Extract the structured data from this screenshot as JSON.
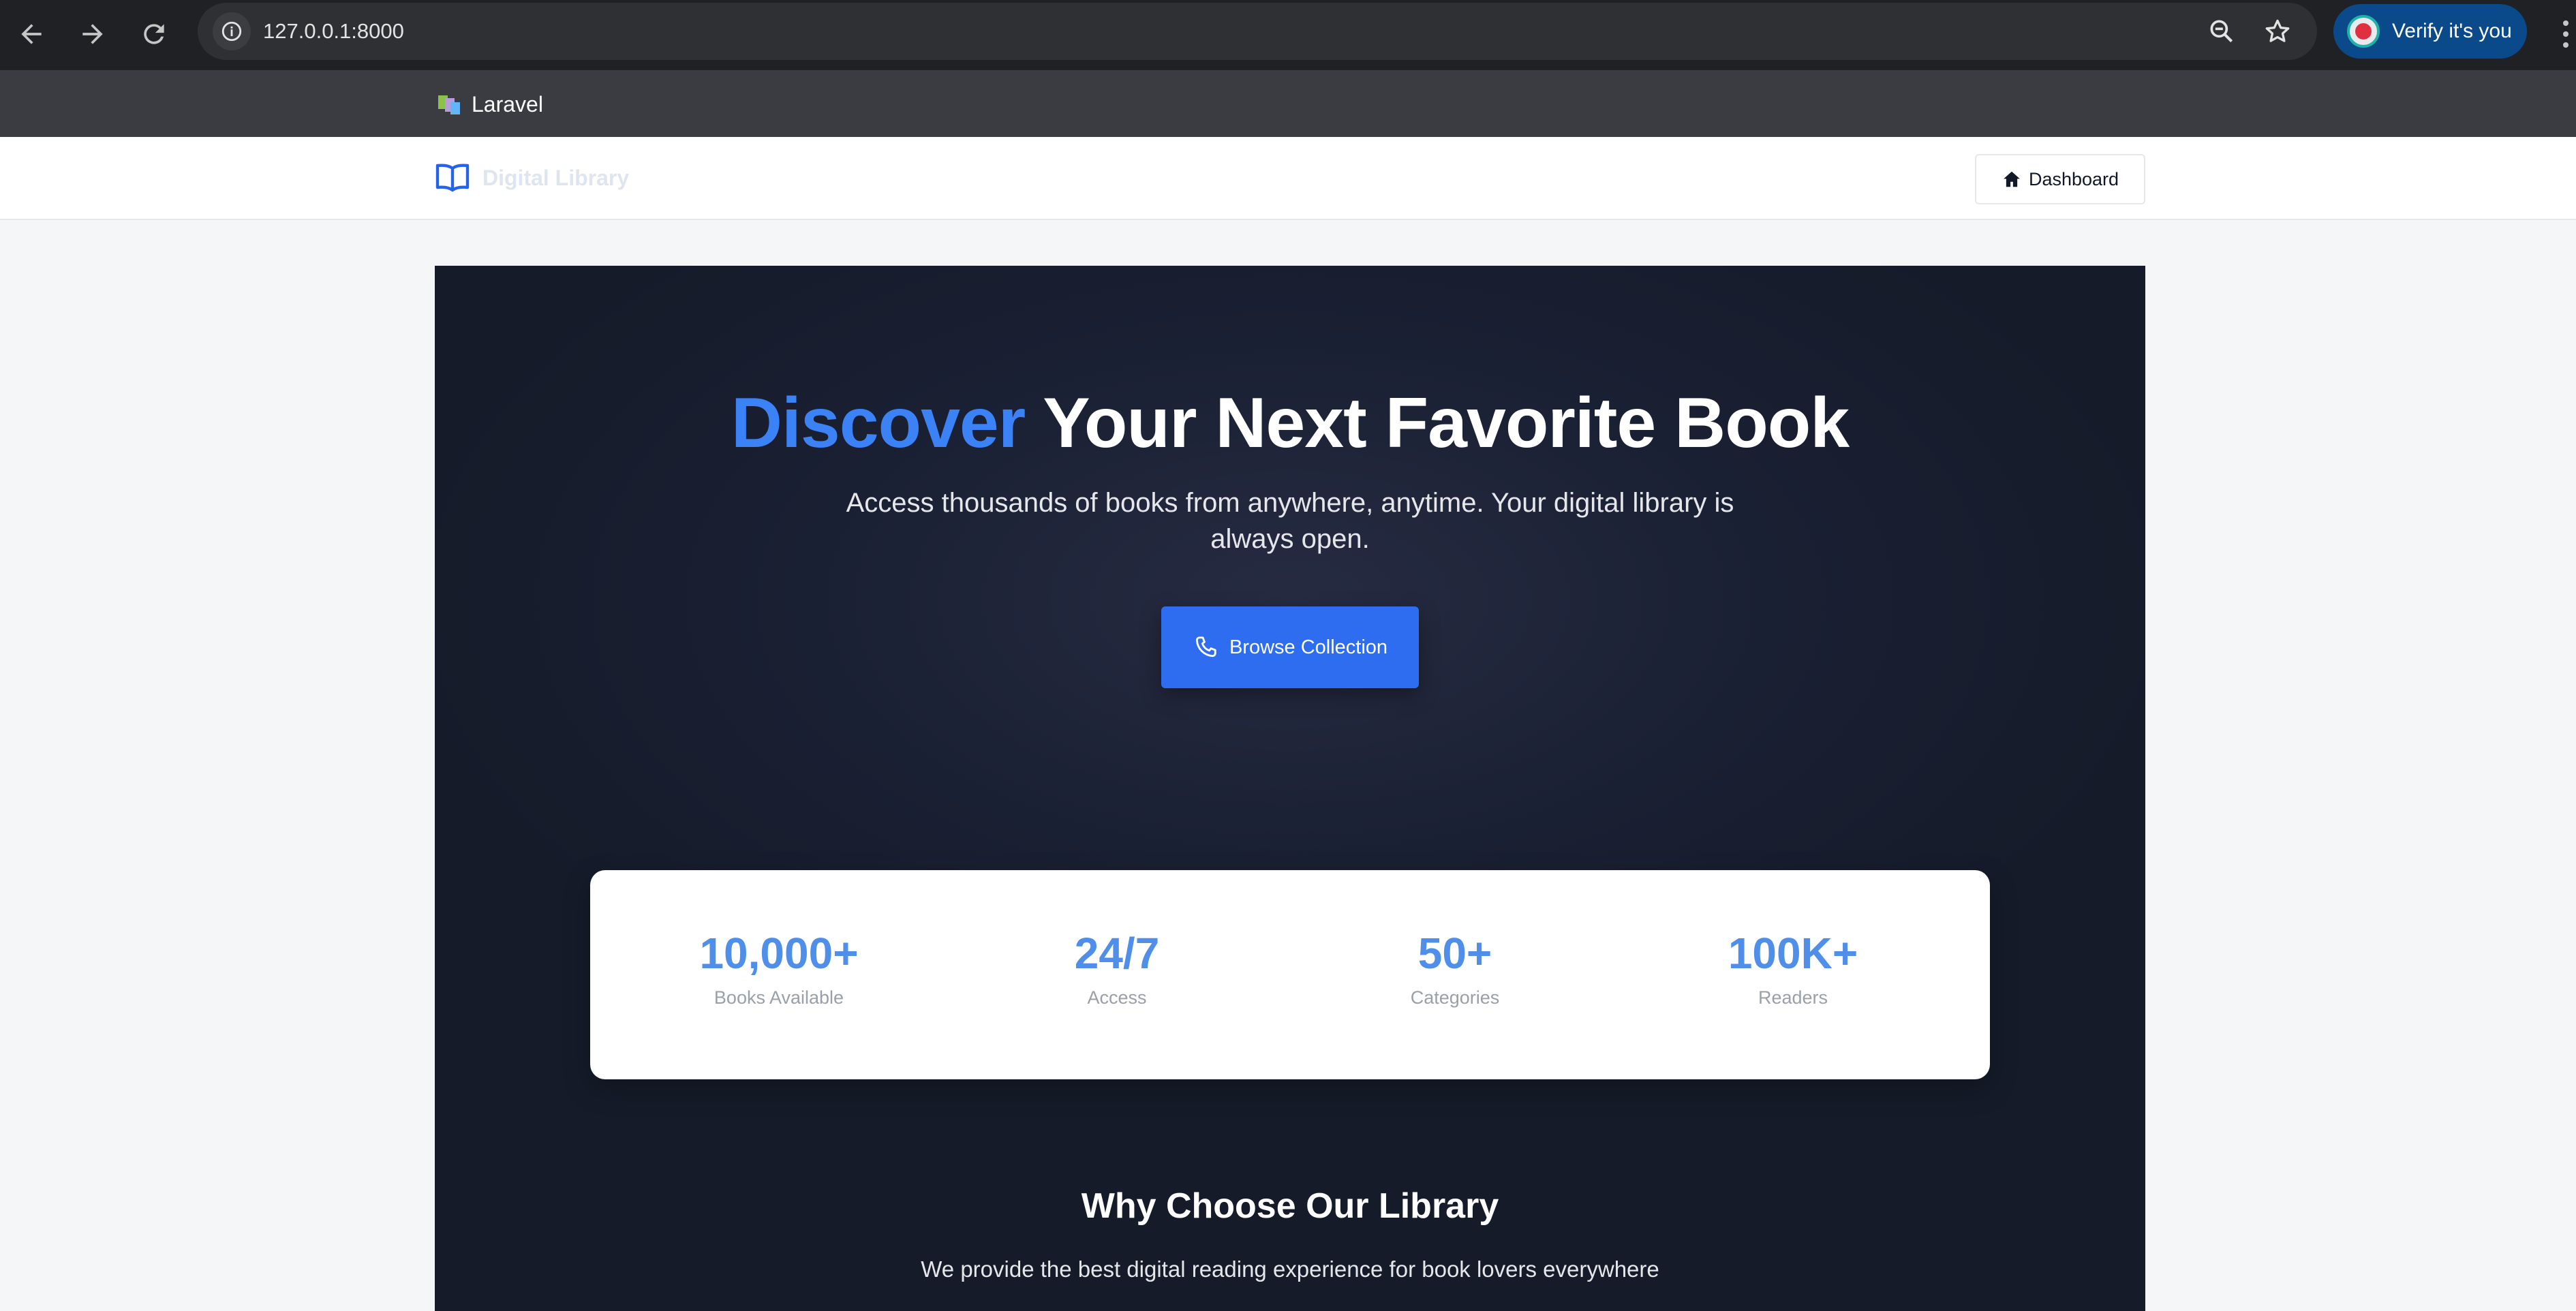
{
  "browser": {
    "url": "127.0.0.1:8000",
    "verify_label": "Verify it's you",
    "tab_title": "Laravel",
    "icons": [
      "back-icon",
      "forward-icon",
      "reload-icon",
      "site-info-icon",
      "zoom-icon",
      "bookmark-star-icon",
      "menu-kebab-icon"
    ]
  },
  "header": {
    "brand_name": "Digital Library",
    "brand_icon": "open-book-icon",
    "dashboard_label": "Dashboard",
    "dashboard_icon": "home-icon"
  },
  "hero": {
    "title_accent": "Discover",
    "title_rest": "Your Next Favorite Book",
    "subtitle": "Access thousands of books from anywhere, anytime. Your digital library is always open.",
    "cta_label": "Browse Collection",
    "cta_icon": "phone-icon"
  },
  "stats": [
    {
      "value": "10,000+",
      "label": "Books Available"
    },
    {
      "value": "24/7",
      "label": "Access"
    },
    {
      "value": "50+",
      "label": "Categories"
    },
    {
      "value": "100K+",
      "label": "Readers"
    }
  ],
  "why": {
    "title": "Why Choose Our Library",
    "subtitle": "We provide the best digital reading experience for book lovers everywhere"
  },
  "colors": {
    "accent": "#3b82f6",
    "cta": "#2f6df0",
    "stat_value": "#4f8fea",
    "hero_bg": "#1a2033"
  }
}
